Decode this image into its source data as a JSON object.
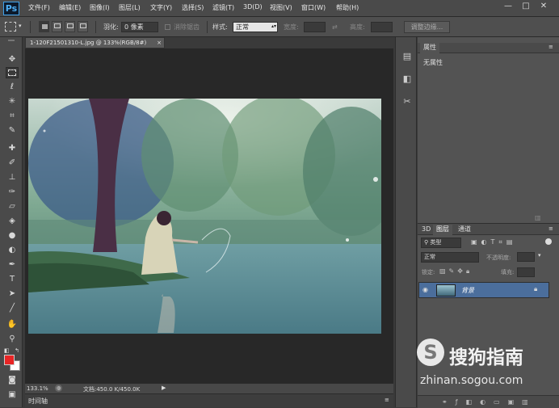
{
  "menubar": {
    "logo": "Ps",
    "items": [
      "文件(F)",
      "编辑(E)",
      "图像(I)",
      "图层(L)",
      "文字(Y)",
      "选择(S)",
      "滤镜(T)",
      "3D(D)",
      "视图(V)",
      "窗口(W)",
      "帮助(H)"
    ],
    "window_controls": [
      "—",
      "□",
      "✕"
    ]
  },
  "options": {
    "feather_label": "羽化:",
    "feather_value": "0 像素",
    "antialias_label": "消除锯齿",
    "style_label": "样式:",
    "style_value": "正常",
    "width_label": "宽度:",
    "height_label": "高度:",
    "refine_edge_label": "调整边缘..."
  },
  "document": {
    "tab_title": "1-120F21501310-L.jpg @ 133%(RGB/8#)",
    "zoom": "133.1%",
    "doc_info": "文档:450.0 K/450.0K",
    "timeline_label": "时间轴"
  },
  "properties_panel": {
    "title": "属性",
    "empty_text": "无属性"
  },
  "layers_panel": {
    "tabs": [
      "3D",
      "图层",
      "通道"
    ],
    "filter_kind": "类型",
    "blend_mode": "正常",
    "opacity_label": "不透明度:",
    "lock_label": "锁定:",
    "fill_label": "填充:",
    "layer_name": "背景"
  },
  "watermark": {
    "brand": "搜狗指南",
    "url": "zhinan.sogou.com"
  },
  "colors": {
    "foreground": "#e82525",
    "background": "#ffffff",
    "selected_layer": "#4b6e9c"
  }
}
